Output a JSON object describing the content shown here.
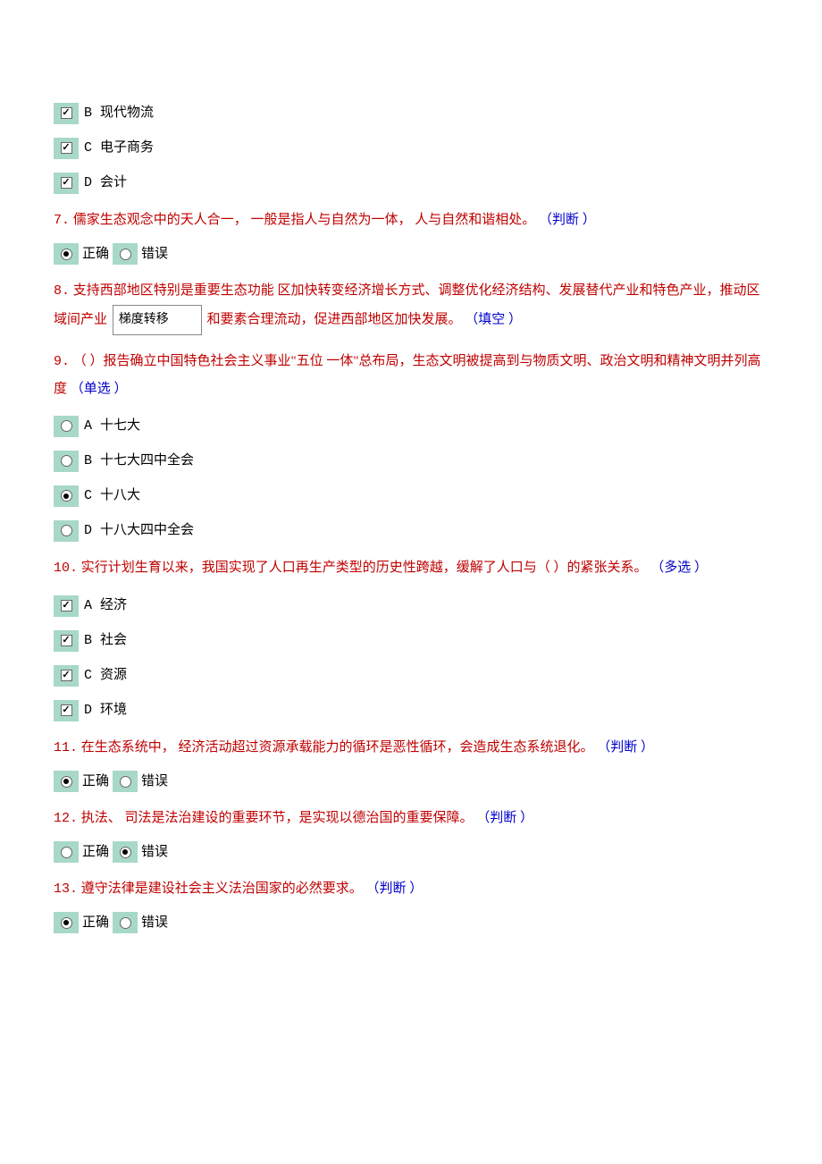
{
  "q6_options": {
    "b": {
      "letter": "B",
      "text": "现代物流"
    },
    "c": {
      "letter": "C",
      "text": "电子商务"
    },
    "d": {
      "letter": "D",
      "text": "会计"
    }
  },
  "q7": {
    "num": "7.",
    "text": "儒家生态观念中的天人合一， 一般是指人与自然为一体， 人与自然和谐相处。",
    "type": "（判断 ）",
    "opt_true": "正确",
    "opt_false": "错误"
  },
  "q8": {
    "num": "8.",
    "text_a": "支持西部地区特别是重要生态功能 区加快转变经济增长方式、调整优化经济结构、发展替代产业和特色产业，推动区域间产业",
    "fill": "梯度转移",
    "text_b": "和要素合理流动，促进西部地区加快发展。",
    "type": "（填空 ）"
  },
  "q9": {
    "num": "9.",
    "text": "（ ）报告确立中国特色社会主义事业\"五位 一体\"总布局，生态文明被提高到与物质文明、政治文明和精神文明并列高度",
    "type": "（单选 ）",
    "a": {
      "letter": "A",
      "text": "十七大"
    },
    "b": {
      "letter": "B",
      "text": "十七大四中全会"
    },
    "c": {
      "letter": "C",
      "text": "十八大"
    },
    "d": {
      "letter": "D",
      "text": "十八大四中全会"
    }
  },
  "q10": {
    "num": "10.",
    "text": "实行计划生育以来，我国实现了人口再生产类型的历史性跨越，缓解了人口与（ ）的紧张关系。",
    "type": "（多选 ）",
    "a": {
      "letter": "A",
      "text": "经济"
    },
    "b": {
      "letter": "B",
      "text": "社会"
    },
    "c": {
      "letter": "C",
      "text": "资源"
    },
    "d": {
      "letter": "D",
      "text": "环境"
    }
  },
  "q11": {
    "num": "11.",
    "text": "在生态系统中， 经济活动超过资源承载能力的循环是恶性循环，会造成生态系统退化。",
    "type": "（判断 ）",
    "opt_true": "正确",
    "opt_false": "错误"
  },
  "q12": {
    "num": "12.",
    "text": "执法、 司法是法治建设的重要环节，是实现以德治国的重要保障。",
    "type": "（判断 ）",
    "opt_true": "正确",
    "opt_false": "错误"
  },
  "q13": {
    "num": "13.",
    "text": "遵守法律是建设社会主义法治国家的必然要求。",
    "type": "（判断 ）",
    "opt_true": "正确",
    "opt_false": "错误"
  }
}
